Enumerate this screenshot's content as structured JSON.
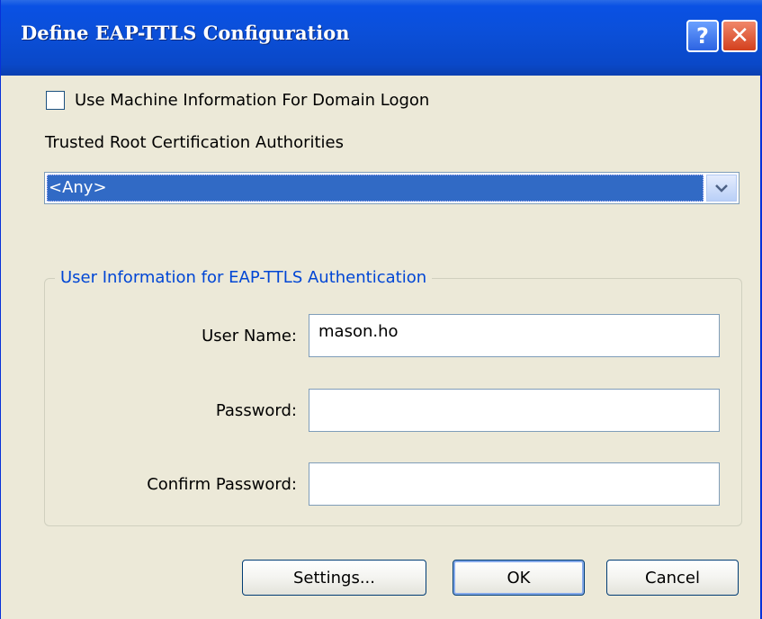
{
  "window": {
    "title": "Define EAP-TTLS Configuration",
    "help_glyph": "?",
    "close_glyph": "✕"
  },
  "machine_info_checkbox": {
    "label": "Use Machine Information For Domain Logon",
    "checked": false
  },
  "trusted_root": {
    "label": "Trusted Root Certification Authorities",
    "selected": "<Any>"
  },
  "user_info_group": {
    "legend": "User Information for EAP-TTLS Authentication",
    "username_label": "User Name:",
    "username_value": "mason.ho",
    "password_label": "Password:",
    "password_value": "",
    "confirm_label": "Confirm Password:",
    "confirm_value": ""
  },
  "buttons": {
    "settings": "Settings...",
    "ok": "OK",
    "cancel": "Cancel"
  },
  "colors": {
    "titlebar": "#0a51e4",
    "selection": "#316ac5",
    "group_legend": "#0046d5",
    "dialog_bg": "#ece9d8"
  }
}
